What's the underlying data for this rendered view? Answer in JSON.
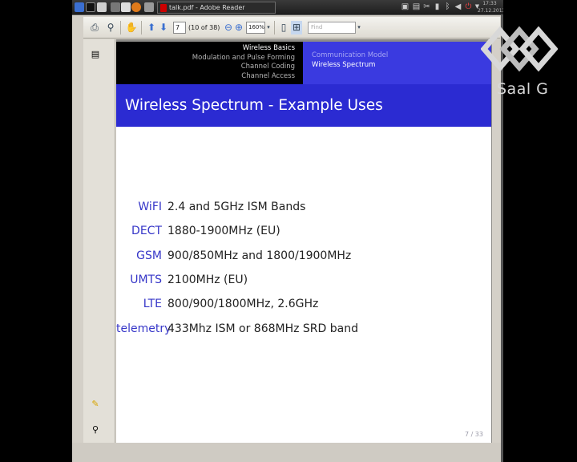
{
  "taskbar": {
    "window_title": "talk.pdf - Adobe Reader",
    "clock_time": "17:33",
    "clock_date": "27.12.2013"
  },
  "toolbar": {
    "page_number": "7",
    "page_of": "(10 of 38)",
    "zoom": "160%",
    "find_placeholder": "Find"
  },
  "slide": {
    "nav_left": [
      "Wireless Basics",
      "Modulation and Pulse Forming",
      "Channel Coding",
      "Channel Access"
    ],
    "nav_right": [
      "Communication Model",
      "Wireless Spectrum"
    ],
    "frame_title": "Wireless Spectrum - Example Uses",
    "rows": [
      {
        "label": "WiFI",
        "value": "2.4 and 5GHz ISM Bands"
      },
      {
        "label": "DECT",
        "value": "1880-1900MHz (EU)"
      },
      {
        "label": "GSM",
        "value": "900/850MHz and 1800/1900MHz"
      },
      {
        "label": "UMTS",
        "value": "2100MHz (EU)"
      },
      {
        "label": "LTE",
        "value": "800/900/1800MHz, 2.6GHz"
      },
      {
        "label": "telemetry",
        "value": "433Mhz ISM or 868MHz SRD band"
      }
    ],
    "page_counter": "7 / 33"
  },
  "watermark": {
    "text": "Saal G"
  },
  "colors": {
    "beamer_blue": "#2b2bd2",
    "beamer_label": "#3636c8"
  }
}
